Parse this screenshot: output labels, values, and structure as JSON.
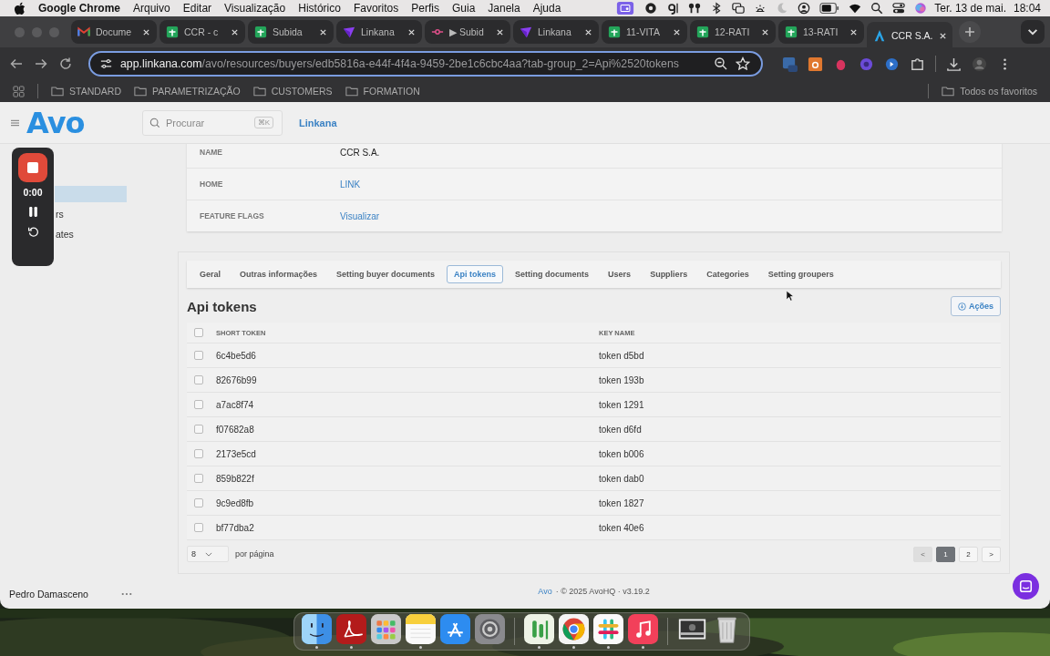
{
  "menubar": {
    "app": "Google Chrome",
    "menus": [
      "Arquivo",
      "Editar",
      "Visualização",
      "Histórico",
      "Favoritos",
      "Perfis",
      "Guia",
      "Janela",
      "Ajuda"
    ],
    "date": "Ter. 13 de mai.",
    "time": "18:04"
  },
  "browser": {
    "tabs": [
      {
        "kind": "gmail",
        "title": "Docume",
        "selected": false
      },
      {
        "kind": "sheets",
        "title": "CCR - c",
        "selected": false
      },
      {
        "kind": "sheets",
        "title": "Subida",
        "selected": false
      },
      {
        "kind": "linkana",
        "title": "Linkana",
        "selected": false
      },
      {
        "kind": "pink",
        "title": "▶ Subid",
        "selected": false
      },
      {
        "kind": "linkana",
        "title": "Linkana",
        "selected": false
      },
      {
        "kind": "sheets",
        "title": "11-VITA",
        "selected": false
      },
      {
        "kind": "sheets",
        "title": "12-RATI",
        "selected": false
      },
      {
        "kind": "sheets",
        "title": "13-RATI",
        "selected": false
      },
      {
        "kind": "avo",
        "title": "CCR S.A.",
        "selected": true
      }
    ],
    "url_host": "app.linkana.com",
    "url_path": "/avo/resources/buyers/edb5816a-e44f-4f4a-9459-2be1c6cbc4aa?tab-group_2=Api%2520tokens",
    "bookmarks": [
      "STANDARD",
      "PARAMETRIZAÇÃO",
      "CUSTOMERS",
      "FORMATION"
    ],
    "all_bookmarks": "Todos os favoritos"
  },
  "app": {
    "logo": "Avo",
    "search": {
      "placeholder": "Procurar",
      "shortcut": "⌘K"
    },
    "header_link": "Linkana",
    "sidebar": {
      "items": [
        {
          "selected": true
        },
        {
          "label": "rs",
          "selected": false
        },
        {
          "label": "ates",
          "selected": false
        }
      ],
      "user": "Pedro Damasceno"
    },
    "recorder": {
      "time": "0:00"
    },
    "details": [
      {
        "label": "NAME",
        "value": "CCR S.A.",
        "kind": "text"
      },
      {
        "label": "HOME",
        "value": "LINK",
        "kind": "link"
      },
      {
        "label": "FEATURE FLAGS",
        "value": "Visualizar",
        "kind": "link"
      }
    ],
    "tabs": [
      {
        "label": "Geral",
        "selected": false
      },
      {
        "label": "Outras informações",
        "selected": false
      },
      {
        "label": "Setting buyer documents",
        "selected": false
      },
      {
        "label": "Api tokens",
        "selected": true
      },
      {
        "label": "Setting documents",
        "selected": false
      },
      {
        "label": "Users",
        "selected": false
      },
      {
        "label": "Suppliers",
        "selected": false
      },
      {
        "label": "Categories",
        "selected": false
      },
      {
        "label": "Setting groupers",
        "selected": false
      }
    ],
    "section_title": "Api tokens",
    "actions_button": "Ações",
    "table": {
      "columns": [
        "SHORT TOKEN",
        "KEY NAME"
      ],
      "all_checked": false,
      "rows": [
        {
          "short_token": "6c4be5d6",
          "key_name": "token d5bd",
          "checked": false
        },
        {
          "short_token": "82676b99",
          "key_name": "token 193b",
          "checked": false
        },
        {
          "short_token": "a7ac8f74",
          "key_name": "token 1291",
          "checked": false
        },
        {
          "short_token": "f07682a8",
          "key_name": "token d6fd",
          "checked": false
        },
        {
          "short_token": "2173e5cd",
          "key_name": "token b006",
          "checked": false
        },
        {
          "short_token": "859b822f",
          "key_name": "token dab0",
          "checked": false
        },
        {
          "short_token": "9c9ed8fb",
          "key_name": "token 1827",
          "checked": false
        },
        {
          "short_token": "bf77dba2",
          "key_name": "token 40e6",
          "checked": false
        }
      ]
    },
    "pagination": {
      "per_page": "8",
      "per_page_label": "por página",
      "prev": "<",
      "next": ">",
      "prev_disabled": true,
      "pages": [
        {
          "label": "1",
          "selected": true
        },
        {
          "label": "2",
          "selected": false
        }
      ]
    },
    "footer": {
      "link": "Avo",
      "text": "· © 2025 AvoHQ · v3.19.2"
    }
  },
  "dock": [
    {
      "kind": "finder",
      "running": true
    },
    {
      "kind": "acrobat",
      "running": true
    },
    {
      "kind": "launchpad",
      "running": false
    },
    {
      "kind": "notes",
      "running": true
    },
    {
      "kind": "appstore",
      "running": false
    },
    {
      "kind": "settings",
      "running": false
    },
    {
      "kind": "separator"
    },
    {
      "kind": "green",
      "running": true
    },
    {
      "kind": "chrome",
      "running": true
    },
    {
      "kind": "slack",
      "running": true
    },
    {
      "kind": "music",
      "running": true
    },
    {
      "kind": "separator"
    },
    {
      "kind": "screenshot",
      "running": false
    },
    {
      "kind": "trash",
      "running": false
    }
  ]
}
